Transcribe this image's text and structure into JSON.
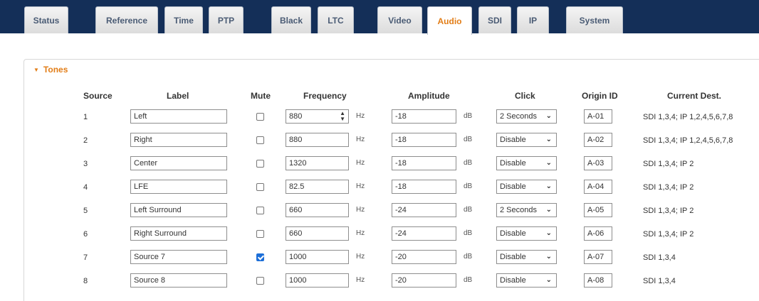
{
  "tabs": [
    {
      "label": "Status",
      "active": false
    },
    {
      "label": "Reference",
      "active": false
    },
    {
      "label": "Time",
      "active": false
    },
    {
      "label": "PTP",
      "active": false
    },
    {
      "label": "Black",
      "active": false
    },
    {
      "label": "LTC",
      "active": false
    },
    {
      "label": "Video",
      "active": false
    },
    {
      "label": "Audio",
      "active": true
    },
    {
      "label": "SDI",
      "active": false
    },
    {
      "label": "IP",
      "active": false
    },
    {
      "label": "System",
      "active": false
    }
  ],
  "section": {
    "title": "Tones"
  },
  "columns": {
    "source": "Source",
    "label": "Label",
    "mute": "Mute",
    "frequency": "Frequency",
    "amplitude": "Amplitude",
    "click": "Click",
    "origin": "Origin ID",
    "dest": "Current Dest."
  },
  "units": {
    "freq": "Hz",
    "amp": "dB"
  },
  "rows": [
    {
      "source": "1",
      "label": "Left",
      "mute": false,
      "frequency": "880",
      "amplitude": "-18",
      "click": "2 Seconds",
      "origin": "A-01",
      "dest": "SDI 1,3,4; IP 1,2,4,5,6,7,8"
    },
    {
      "source": "2",
      "label": "Right",
      "mute": false,
      "frequency": "880",
      "amplitude": "-18",
      "click": "Disable",
      "origin": "A-02",
      "dest": "SDI 1,3,4; IP 1,2,4,5,6,7,8"
    },
    {
      "source": "3",
      "label": "Center",
      "mute": false,
      "frequency": "1320",
      "amplitude": "-18",
      "click": "Disable",
      "origin": "A-03",
      "dest": "SDI 1,3,4; IP 2"
    },
    {
      "source": "4",
      "label": "LFE",
      "mute": false,
      "frequency": "82.5",
      "amplitude": "-18",
      "click": "Disable",
      "origin": "A-04",
      "dest": "SDI 1,3,4; IP 2"
    },
    {
      "source": "5",
      "label": "Left Surround",
      "mute": false,
      "frequency": "660",
      "amplitude": "-24",
      "click": "2 Seconds",
      "origin": "A-05",
      "dest": "SDI 1,3,4; IP 2"
    },
    {
      "source": "6",
      "label": "Right Surround",
      "mute": false,
      "frequency": "660",
      "amplitude": "-24",
      "click": "Disable",
      "origin": "A-06",
      "dest": "SDI 1,3,4; IP 2"
    },
    {
      "source": "7",
      "label": "Source 7",
      "mute": true,
      "frequency": "1000",
      "amplitude": "-20",
      "click": "Disable",
      "origin": "A-07",
      "dest": "SDI 1,3,4"
    },
    {
      "source": "8",
      "label": "Source 8",
      "mute": false,
      "frequency": "1000",
      "amplitude": "-20",
      "click": "Disable",
      "origin": "A-08",
      "dest": "SDI 1,3,4"
    }
  ]
}
